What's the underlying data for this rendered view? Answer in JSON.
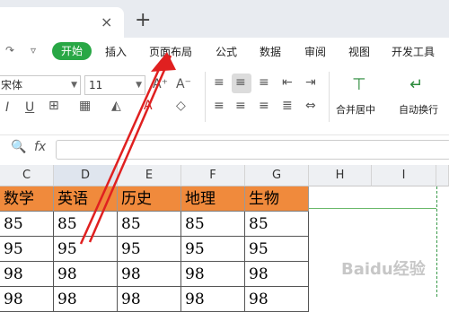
{
  "window": {
    "tab_close": "×",
    "tab_add": "+"
  },
  "quick_access": {
    "redo": "↷",
    "more": "▿"
  },
  "menu": {
    "items": [
      {
        "label": "开始",
        "active": true
      },
      {
        "label": "插入"
      },
      {
        "label": "页面布局"
      },
      {
        "label": "公式"
      },
      {
        "label": "数据"
      },
      {
        "label": "审阅"
      },
      {
        "label": "视图"
      },
      {
        "label": "开发工具"
      }
    ]
  },
  "toolbar": {
    "font_name": "宋体",
    "font_size": "11",
    "grow_font": "A⁺",
    "shrink_font": "A⁻",
    "merge_center_label": "合并居中",
    "wrap_text_label": "自动换行"
  },
  "formula_bar": {
    "fx_label": "fx"
  },
  "columns": [
    "C",
    "D",
    "E",
    "F",
    "G",
    "H",
    "I"
  ],
  "table": {
    "headers": [
      "数学",
      "英语",
      "历史",
      "地理",
      "生物"
    ],
    "rows": [
      [
        "85",
        "85",
        "85",
        "85",
        "85"
      ],
      [
        "95",
        "95",
        "95",
        "95",
        "95"
      ],
      [
        "98",
        "98",
        "98",
        "98",
        "98"
      ],
      [
        "98",
        "98",
        "98",
        "98",
        "98"
      ]
    ]
  },
  "colors": {
    "accent_green": "#28a745",
    "header_orange": "#f08a3c",
    "arrow_red": "#e02020"
  },
  "watermark": "Baidu经验"
}
